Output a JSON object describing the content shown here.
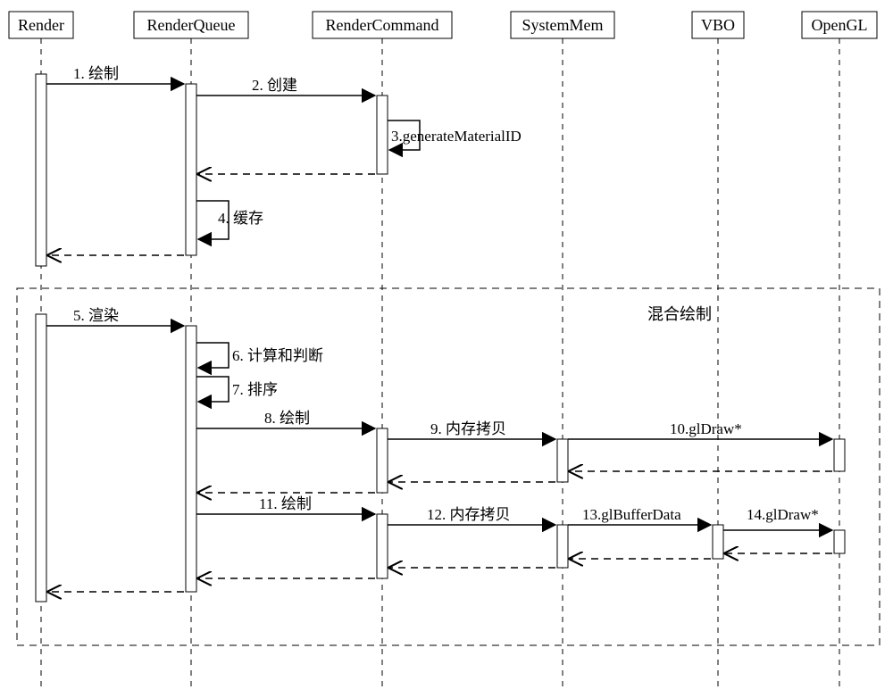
{
  "lifelines": {
    "render": "Render",
    "renderQueue": "RenderQueue",
    "renderCommand": "RenderCommand",
    "systemMem": "SystemMem",
    "vbo": "VBO",
    "opengl": "OpenGL"
  },
  "messages": {
    "m1": "1. 绘制",
    "m2": "2. 创建",
    "m3": "3.generateMaterialID",
    "m4": "4. 缓存",
    "m5": "5. 渲染",
    "m6": "6. 计算和判断",
    "m7": "7. 排序",
    "m8": "8. 绘制",
    "m9": "9. 内存拷贝",
    "m10": "10.glDraw*",
    "m11": "11. 绘制",
    "m12": "12. 内存拷贝",
    "m13": "13.glBufferData",
    "m14": "14.glDraw*"
  },
  "fragment": {
    "label": "混合绘制"
  }
}
